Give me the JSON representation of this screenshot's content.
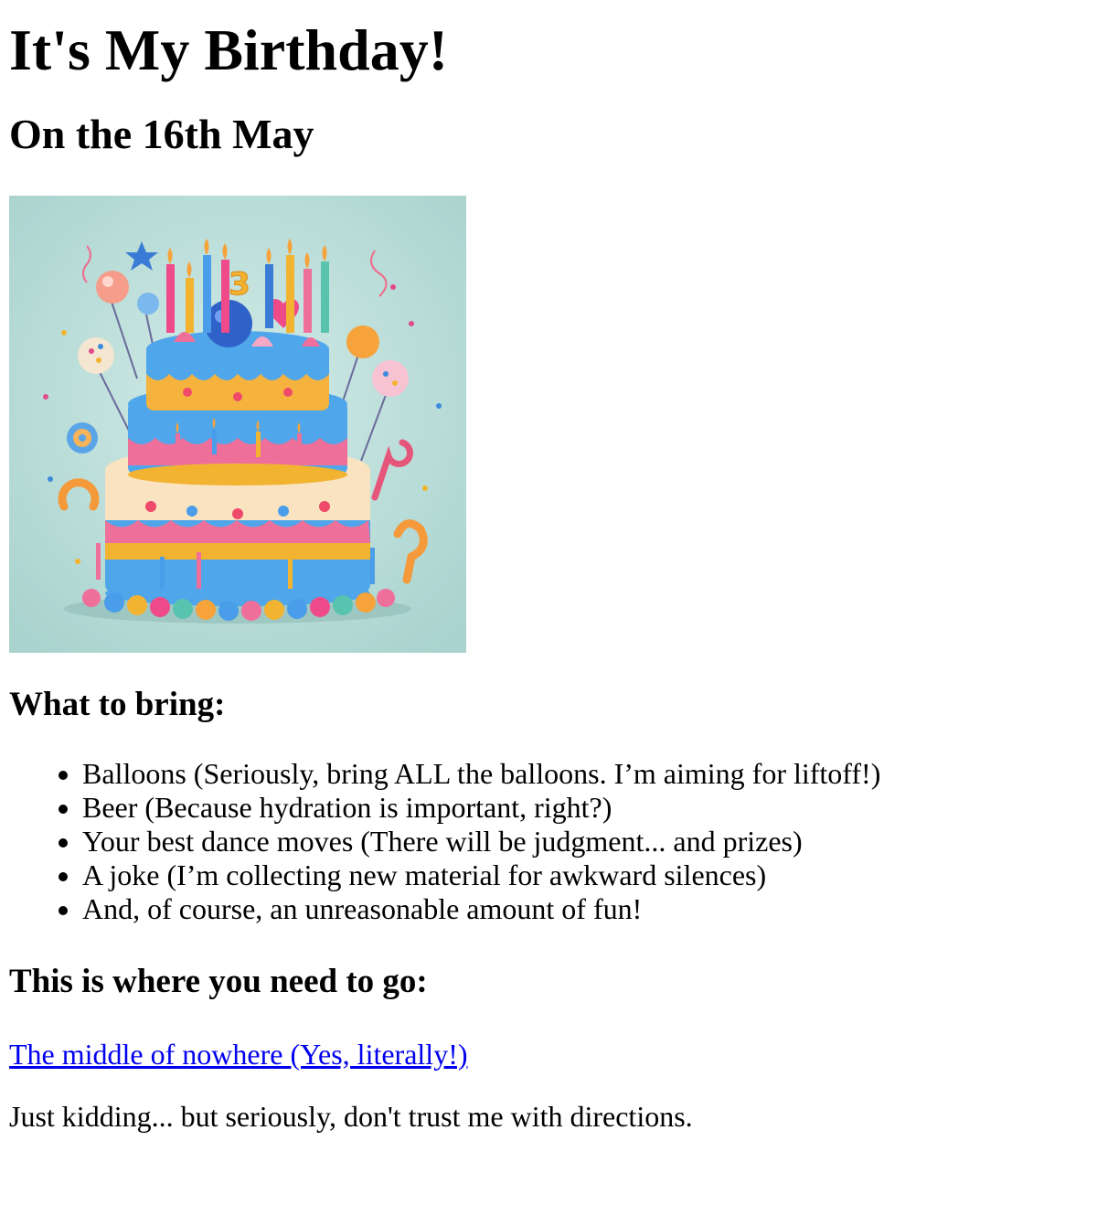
{
  "header": {
    "title": "It's My Birthday!",
    "subtitle": "On the 16th May"
  },
  "hero_image": {
    "icon": "birthday-cake-illustration",
    "background_color": "#b5dcd8",
    "cake_number": "3"
  },
  "bring": {
    "heading": "What to bring:",
    "items": [
      "Balloons (Seriously, bring ALL the balloons. I’m aiming for liftoff!)",
      "Beer (Because hydration is important, right?)",
      "Your best dance moves (There will be judgment... and prizes)",
      "A joke (I’m collecting new material for awkward silences)",
      "And, of course, an unreasonable amount of fun!"
    ]
  },
  "location": {
    "heading": "This is where you need to go:",
    "link_text": "The middle of nowhere (Yes, literally!)",
    "note": "Just kidding... but seriously, don't trust me with directions."
  },
  "colors": {
    "link": "#0000ee",
    "text": "#000000",
    "background": "#ffffff"
  }
}
